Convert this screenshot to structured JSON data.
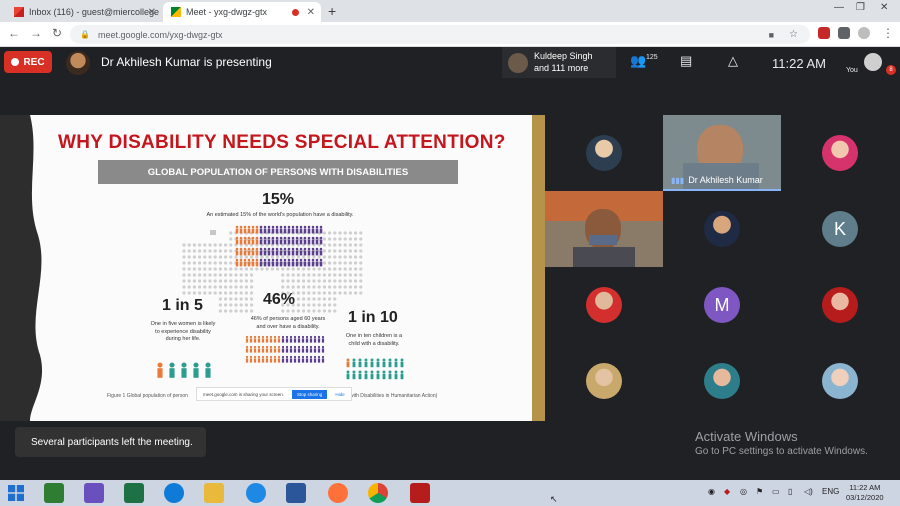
{
  "browser": {
    "tabs": [
      {
        "label": "Inbox (116) - guest@miercollege"
      },
      {
        "label": "Meet - yxg-dwgz-gtx"
      }
    ],
    "url": "meet.google.com/yxg-dwgz-gtx"
  },
  "meet": {
    "rec_label": "REC",
    "presenting_text": "Dr Akhilesh Kumar is presenting",
    "participants_name": "Kuldeep Singh",
    "participants_more": "and 111 more",
    "participant_count": "125",
    "time": "11:22 AM",
    "you_label": "You",
    "notification_badge": "8",
    "toast": "Several participants left the meeting.",
    "speaker_label": "Dr Akhilesh Kumar",
    "tile_letters": [
      "K",
      "M"
    ]
  },
  "slide": {
    "title": "WHY DISABILITY NEEDS SPECIAL ATTENTION?",
    "banner": "GLOBAL POPULATION OF PERSONS WITH DISABILITIES",
    "stat_15": "15%",
    "stat_15_desc": "An estimated 15% of the world's population have a disability.",
    "stat_1in5": "1 in 5",
    "stat_1in5_desc": "One in five women is likely to experience disability during her life.",
    "stat_46": "46%",
    "stat_46_desc": "46% of persons aged 60 years and over have a disability.",
    "stat_1in10": "1 in 10",
    "stat_1in10_desc": "One in ten children is a child with a disability.",
    "fig_caption": "Figure 1 Global population of person",
    "fig_caption_right": "with Disabilities in Humanitarian Action)",
    "share_text": "meet.google.com is sharing your screen.",
    "stop_sharing": "Stop sharing",
    "hide": "Hide"
  },
  "watermark": {
    "title": "Activate Windows",
    "subtitle": "Go to PC settings to activate Windows."
  },
  "taskbar": {
    "lang": "ENG",
    "time": "11:22 AM",
    "date": "03/12/2020"
  },
  "colors": {
    "rec": "#d93025",
    "slide_title": "#c4161c",
    "accent_orange": "#e87b3a",
    "accent_purple": "#5b3e8e",
    "accent_teal": "#2a9d8f"
  }
}
